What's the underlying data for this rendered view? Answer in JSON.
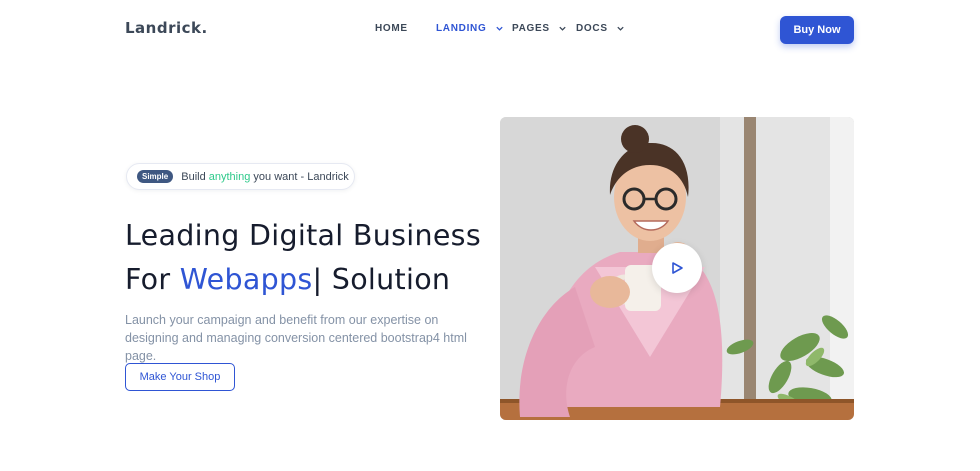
{
  "brand": {
    "logo": "Landrick."
  },
  "nav": {
    "items": [
      {
        "label": "HOME",
        "active": false,
        "dropdown": false
      },
      {
        "label": "LANDING",
        "active": true,
        "dropdown": true
      },
      {
        "label": "PAGES",
        "active": false,
        "dropdown": true
      },
      {
        "label": "DOCS",
        "active": false,
        "dropdown": true
      }
    ],
    "buy_label": "Buy Now"
  },
  "hero": {
    "badge_tag": "Simple",
    "badge_text_before": "Build ",
    "badge_text_highlight": "anything",
    "badge_text_after": " you want - Landrick",
    "headline_line1": "Leading Digital Business",
    "headline_line2_prefix": "For ",
    "headline_line2_highlight": "Webapps",
    "headline_line2_cursor": "|",
    "headline_line2_suffix": " Solution",
    "description": "Launch your campaign and benefit from our expertise on designing and managing conversion centered bootstrap4 html page.",
    "cta_label": "Make Your Shop"
  },
  "colors": {
    "primary": "#2f55d4",
    "heading": "#161c2d",
    "muted": "#8492a6",
    "success": "#2eca8b"
  },
  "icons": {
    "play": "play-icon",
    "chevron": "chevron-down-icon"
  }
}
